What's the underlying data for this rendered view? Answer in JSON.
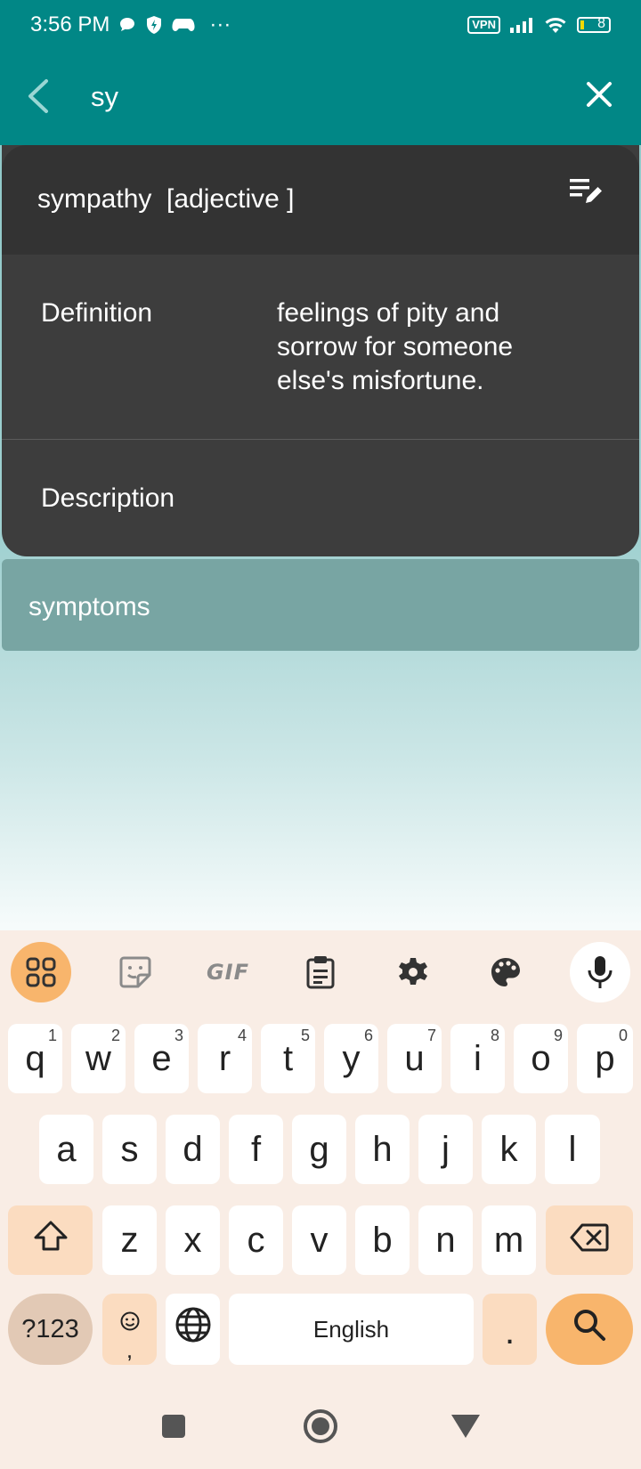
{
  "status_bar": {
    "time": "3:56 PM",
    "notification_icons": [
      "chat-bubble-icon",
      "shield-bolt-icon",
      "game-controller-icon"
    ],
    "more_dots": "···",
    "vpn": "VPN",
    "battery_level": "8"
  },
  "app_bar": {
    "back_icon": "back-chevron-icon",
    "search_value": "sy",
    "clear_icon": "close-icon"
  },
  "result_card": {
    "word_line": "sympathy  [adjective ]",
    "edit_icon": "edit-list-icon",
    "definition_label": "Definition",
    "definition_text": "feelings of pity and sorrow for someone else's misfortune.",
    "description_label": "Description"
  },
  "suggestions": [
    {
      "label": "symptoms"
    }
  ],
  "keyboard": {
    "toolbar": [
      "apps-grid-icon",
      "sticker-icon",
      "GIF",
      "clipboard-icon",
      "settings-gear-icon",
      "palette-icon",
      "mic-icon"
    ],
    "gif_label": "GIF",
    "row1": [
      {
        "k": "q",
        "h": "1"
      },
      {
        "k": "w",
        "h": "2"
      },
      {
        "k": "e",
        "h": "3"
      },
      {
        "k": "r",
        "h": "4"
      },
      {
        "k": "t",
        "h": "5"
      },
      {
        "k": "y",
        "h": "6"
      },
      {
        "k": "u",
        "h": "7"
      },
      {
        "k": "i",
        "h": "8"
      },
      {
        "k": "o",
        "h": "9"
      },
      {
        "k": "p",
        "h": "0"
      }
    ],
    "row2": [
      "a",
      "s",
      "d",
      "f",
      "g",
      "h",
      "j",
      "k",
      "l"
    ],
    "row3": [
      "z",
      "x",
      "c",
      "v",
      "b",
      "n",
      "m"
    ],
    "mode_key": "?123",
    "emoji_key_sub": ",",
    "space_label": "English",
    "period_key": ".",
    "icons": {
      "shift": "shift-arrow-icon",
      "backspace": "backspace-icon",
      "emoji": "smiley-icon",
      "language": "globe-icon",
      "action": "search-icon"
    }
  },
  "nav_bar": [
    "recents-square-icon",
    "home-circle-icon",
    "back-triangle-icon"
  ],
  "colors": {
    "teal": "#018786",
    "card_dark": "#3d3d3d",
    "card_header": "#333333",
    "suggestion_bg": "#78a5a3",
    "keyboard_bg": "#f9ede5",
    "accent_orange": "#f8b56c"
  }
}
